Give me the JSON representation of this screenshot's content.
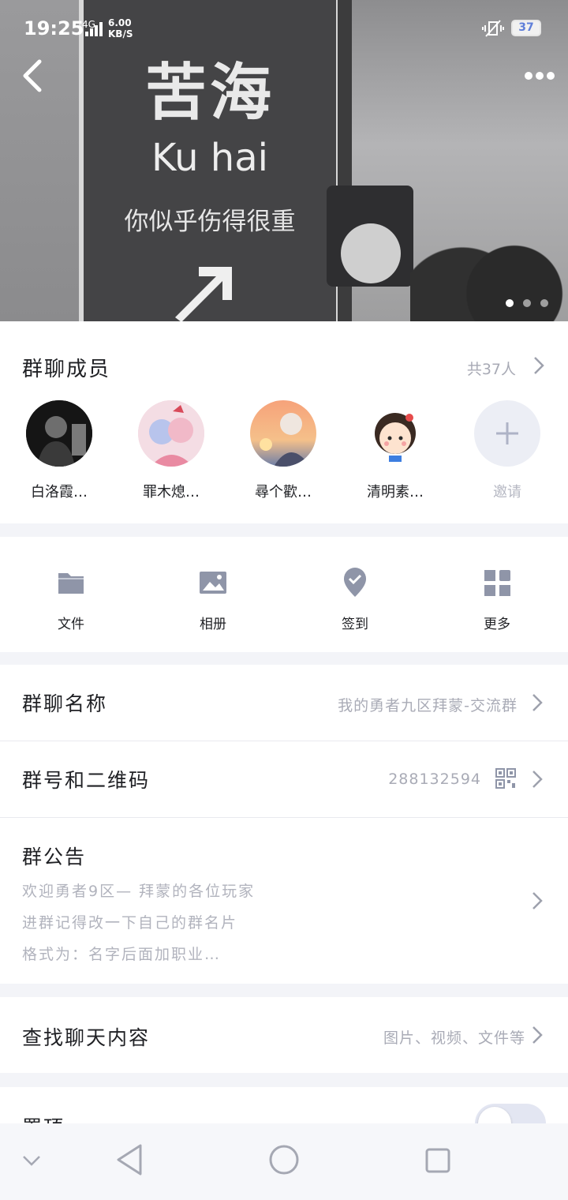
{
  "status_bar": {
    "time": "19:25",
    "network": "4G",
    "speed_value": "6.00",
    "speed_unit": "KB/S",
    "battery": "37"
  },
  "hero": {
    "sign_title": "苦海",
    "sign_subtitle": "Ku hai",
    "sign_line": "你似乎伤得很重",
    "page_count": 3,
    "active_page": 1
  },
  "members": {
    "title": "群聊成员",
    "count": "共37人",
    "list": [
      {
        "name": "白洛霞…"
      },
      {
        "name": "罪木熄…"
      },
      {
        "name": "尋个歡…"
      },
      {
        "name": "清明素…"
      }
    ],
    "invite_label": "邀请"
  },
  "tools": [
    {
      "label": "文件",
      "icon": "folder-icon"
    },
    {
      "label": "相册",
      "icon": "image-icon"
    },
    {
      "label": "签到",
      "icon": "checkin-icon"
    },
    {
      "label": "更多",
      "icon": "grid-icon"
    }
  ],
  "group_name": {
    "label": "群聊名称",
    "value": "我的勇者九区拜蒙-交流群"
  },
  "group_id": {
    "label": "群号和二维码",
    "value": "288132594"
  },
  "notice": {
    "label": "群公告",
    "lines": [
      "欢迎勇者9区— 拜蒙的各位玩家",
      "进群记得改一下自己的群名片",
      "格式为：名字后面加职业…"
    ]
  },
  "search": {
    "label": "查找聊天内容",
    "hint": "图片、视频、文件等"
  },
  "pin": {
    "label": "置顶",
    "enabled": false
  },
  "colors": {
    "accent_gray": "#8f95a8",
    "muted_text": "#a9abb6",
    "background": "#f3f4f8"
  }
}
